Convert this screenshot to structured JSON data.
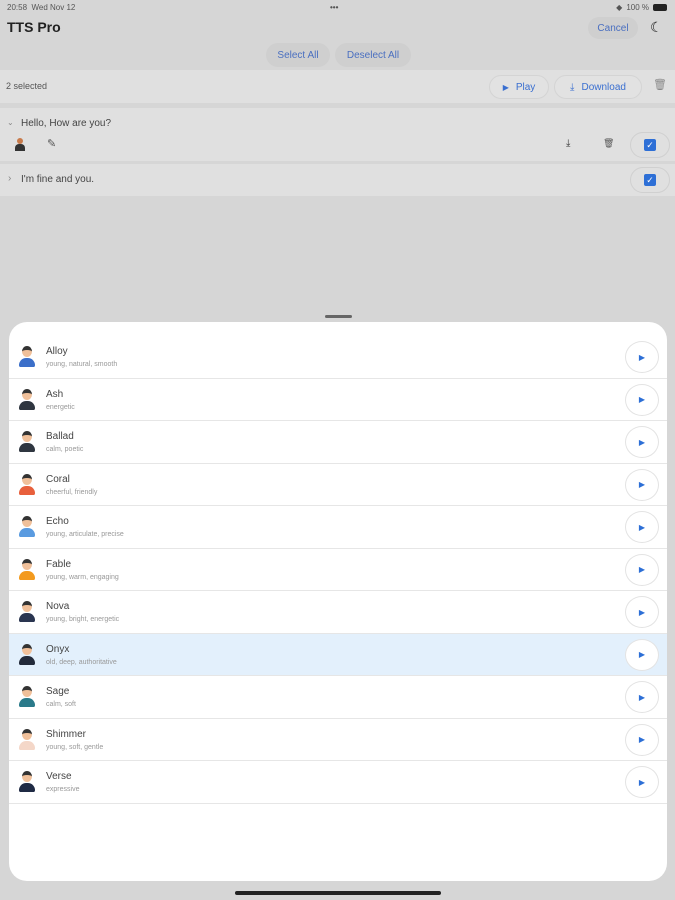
{
  "status": {
    "time": "20:58",
    "date": "Wed Nov 12",
    "battery": "100 %"
  },
  "header": {
    "title": "TTS Pro",
    "cancel": "Cancel",
    "select_all": "Select All",
    "deselect_all": "Deselect All"
  },
  "toolbar": {
    "selected": "2 selected",
    "play": "Play",
    "download": "Download"
  },
  "items": [
    {
      "text": "Hello, How are you?",
      "checked": true,
      "expanded": true
    },
    {
      "text": "I'm fine and you.",
      "checked": true,
      "expanded": false
    }
  ],
  "voices": [
    {
      "name": "Alloy",
      "desc": "young, natural, smooth",
      "color": "#3b6fc9"
    },
    {
      "name": "Ash",
      "desc": "energetic",
      "color": "#2f3640"
    },
    {
      "name": "Ballad",
      "desc": "calm, poetic",
      "color": "#2f3640"
    },
    {
      "name": "Coral",
      "desc": "cheerful, friendly",
      "color": "#e8603c"
    },
    {
      "name": "Echo",
      "desc": "young, articulate, precise",
      "color": "#5a9be0"
    },
    {
      "name": "Fable",
      "desc": "young, warm, engaging",
      "color": "#f39a1e"
    },
    {
      "name": "Nova",
      "desc": "young, bright, energetic",
      "color": "#2a3550"
    },
    {
      "name": "Onyx",
      "desc": "old, deep, authoritative",
      "color": "#222a3a",
      "selected": true
    },
    {
      "name": "Sage",
      "desc": "calm, soft",
      "color": "#2a7a8a"
    },
    {
      "name": "Shimmer",
      "desc": "young, soft, gentle",
      "color": "#f4d7c8"
    },
    {
      "name": "Verse",
      "desc": "expressive",
      "color": "#1f2a44"
    }
  ]
}
